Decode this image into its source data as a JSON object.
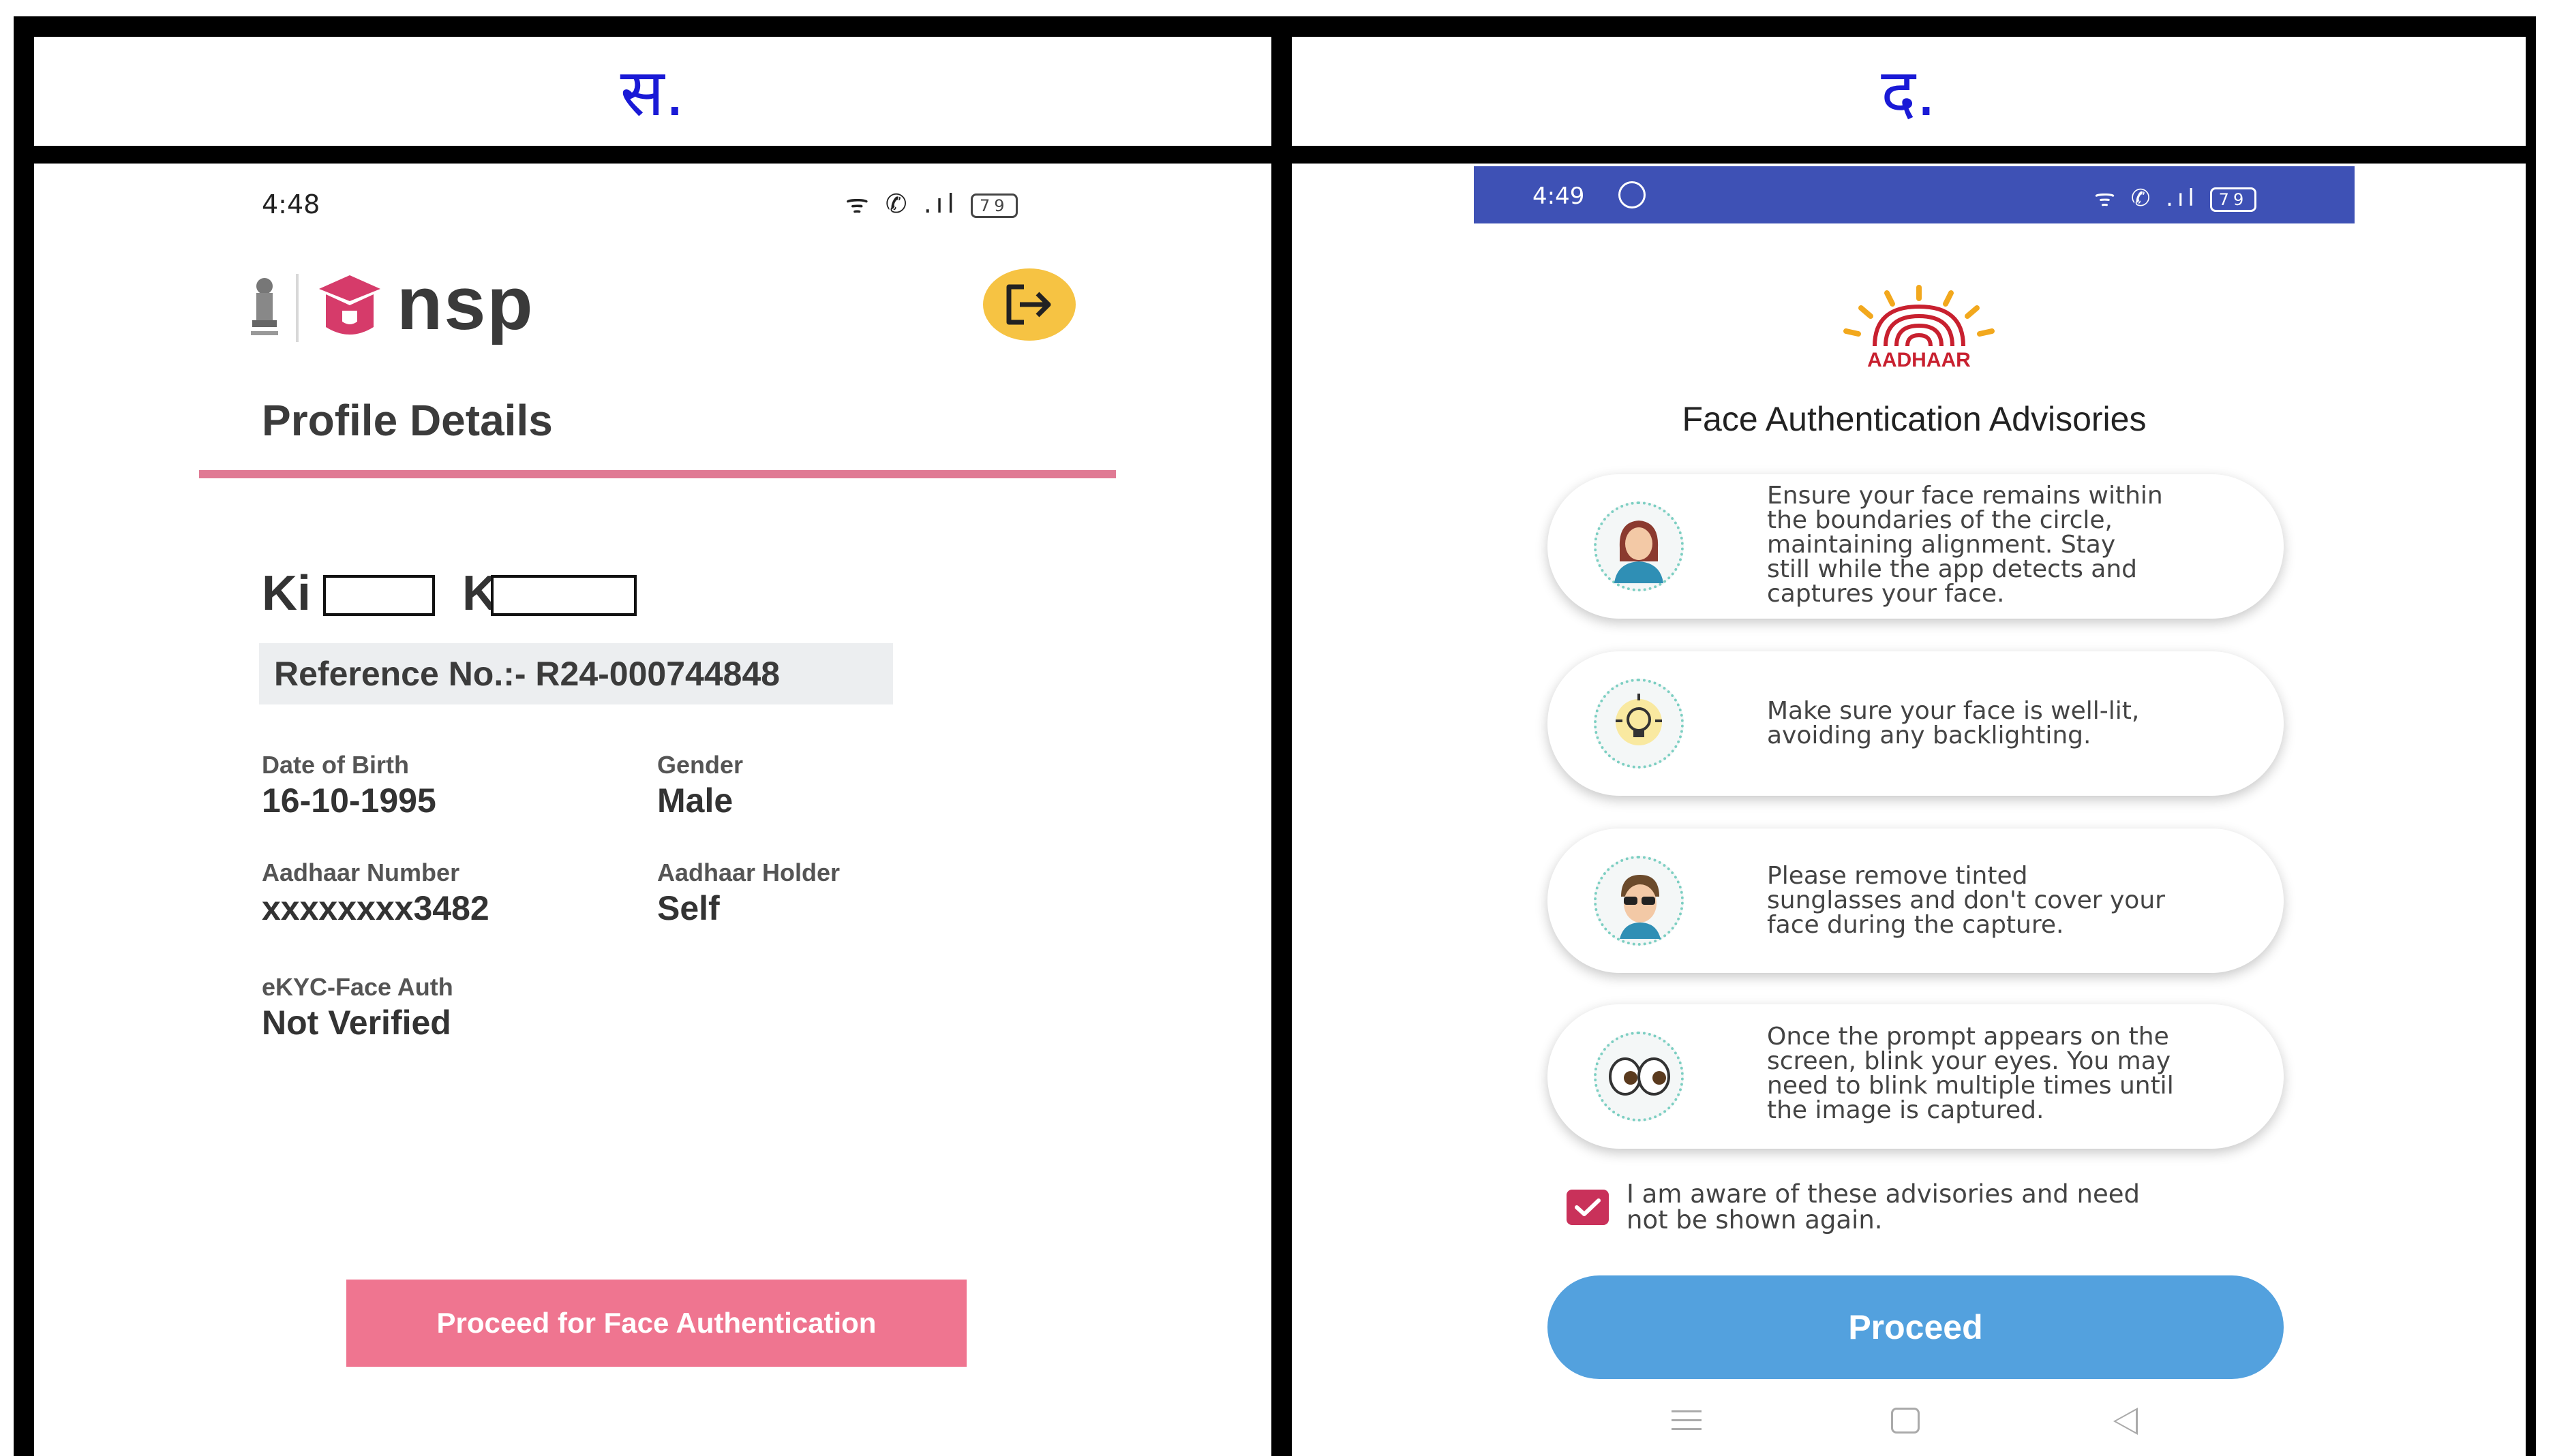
{
  "panels": {
    "left_label": "स.",
    "right_label": "द."
  },
  "nsp": {
    "status_time": "4:48",
    "status_icons": "ᯤ ✆ .ıl",
    "battery": "79",
    "logo_text": "nsp",
    "page_title": "Profile Details",
    "name_visible_start": "Ki",
    "name_visible_mid": "K",
    "reference": "Reference No.:- R24-000744848",
    "dob_label": "Date of Birth",
    "dob_value": "16-10-1995",
    "gender_label": "Gender",
    "gender_value": "Male",
    "aadhaar_label": "Aadhaar Number",
    "aadhaar_value": "xxxxxxxx3482",
    "holder_label": "Aadhaar Holder",
    "holder_value": "Self",
    "ekyc_label": "eKYC-Face Auth",
    "ekyc_value": "Not Verified",
    "face_auth_button": "Proceed for Face Authentication",
    "colors": {
      "accent_pink": "#ef7590",
      "rule_pink": "#e07a94",
      "logout_yellow": "#f6c343"
    }
  },
  "aadhaar": {
    "status_time": "4:49",
    "status_icons": "ᯤ ✆ .ıl",
    "battery": "79",
    "logo_text": "AADHAAR",
    "title": "Face Authentication Advisories",
    "advisories": [
      {
        "lines": [
          "Ensure your face remains within",
          "the boundaries of the circle,",
          "maintaining alignment. Stay",
          "still while the app detects and",
          "captures your face."
        ],
        "icon": "face-in-circle-icon"
      },
      {
        "lines": [
          "Make sure your face is well-lit,",
          "avoiding any backlighting."
        ],
        "icon": "light-bulb-icon"
      },
      {
        "lines": [
          "Please remove tinted",
          "sunglasses and don't cover your",
          "face during the capture."
        ],
        "icon": "sunglasses-face-icon"
      },
      {
        "lines": [
          "Once the prompt appears on the",
          "screen, blink your eyes. You may",
          "need to blink multiple times until",
          "the image is captured."
        ],
        "icon": "eyes-blink-icon"
      }
    ],
    "checkbox_lines": [
      "I am aware of these advisories and need",
      "not be shown again."
    ],
    "checkbox_checked": true,
    "proceed_button": "Proceed",
    "colors": {
      "status_bar": "#3e51b5",
      "proceed_blue": "#53a1de",
      "checkbox": "#c9315a"
    }
  }
}
